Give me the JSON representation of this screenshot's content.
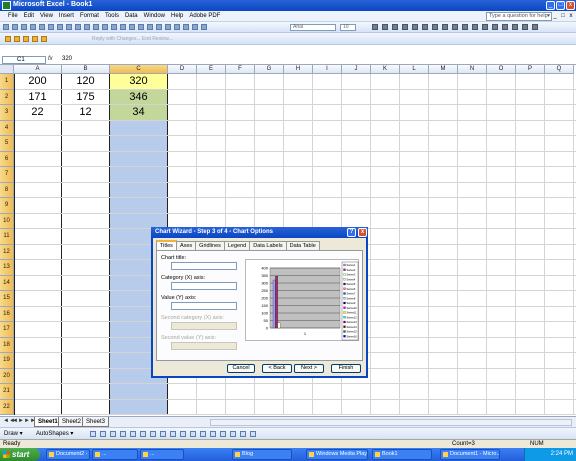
{
  "window": {
    "title": "Microsoft Excel - Book1",
    "controls": {
      "min": "_",
      "max": "□",
      "close": "x"
    }
  },
  "menu": {
    "items": [
      "File",
      "Edit",
      "View",
      "Insert",
      "Format",
      "Tools",
      "Data",
      "Window",
      "Help",
      "Adobe PDF"
    ],
    "help_placeholder": "Type a question for help",
    "help_arrow": "▾",
    "mdi": [
      "_",
      "□",
      "x"
    ]
  },
  "toolbar": {
    "reply_text": "Reply with Changes... End Review...",
    "font_name": "Arial",
    "font_size": "10"
  },
  "formula_bar": {
    "name_box": "C1",
    "fx_label": "fx",
    "formula": "320"
  },
  "grid": {
    "columns": [
      "A",
      "B",
      "C",
      "D",
      "E",
      "F",
      "G",
      "H",
      "I",
      "J",
      "K",
      "L",
      "M",
      "N",
      "O",
      "P",
      "Q"
    ],
    "rows": [
      "1",
      "2",
      "3",
      "4",
      "5",
      "6",
      "7",
      "8",
      "9",
      "10",
      "11",
      "12",
      "13",
      "14",
      "15",
      "16",
      "17",
      "18",
      "19",
      "20",
      "21",
      "22"
    ],
    "selected_column": "C",
    "cells": [
      {
        "row": 1,
        "col": "A",
        "value": "200"
      },
      {
        "row": 1,
        "col": "B",
        "value": "120"
      },
      {
        "row": 1,
        "col": "C",
        "value": "320",
        "bg": "#ffff99"
      },
      {
        "row": 2,
        "col": "A",
        "value": "171"
      },
      {
        "row": 2,
        "col": "B",
        "value": "175"
      },
      {
        "row": 2,
        "col": "C",
        "value": "346",
        "bg": "#c4d79b"
      },
      {
        "row": 3,
        "col": "A",
        "value": "22"
      },
      {
        "row": 3,
        "col": "B",
        "value": "12"
      },
      {
        "row": 3,
        "col": "C",
        "value": "34",
        "bg": "#c4d79b"
      }
    ]
  },
  "sheets": {
    "tabs": [
      "Sheet1",
      "Sheet2",
      "Sheet3"
    ],
    "active": "Sheet1",
    "nav": [
      "◄◄",
      "◄",
      "►",
      "►►"
    ]
  },
  "drawing_toolbar": {
    "draw_label": "Draw ▾",
    "autoshapes_label": "AutoShapes ▾"
  },
  "status": {
    "left": "Ready",
    "count": "Count=3",
    "num": "NUM"
  },
  "dialog": {
    "title": "Chart Wizard - Step 3 of 4 - Chart Options",
    "help_btn": "?",
    "close_btn": "x",
    "tabs": [
      "Titles",
      "Axes",
      "Gridlines",
      "Legend",
      "Data Labels",
      "Data Table"
    ],
    "active_tab": "Titles",
    "fields": {
      "chart_title": "Chart title:",
      "category_x": "Category (X) axis:",
      "value_y": "Value (Y) axis:",
      "second_category_x": "Second category (X) axis:",
      "second_value_y": "Second value (Y) axis:"
    },
    "buttons": {
      "cancel": "Cancel",
      "back": "< Back",
      "next": "Next >",
      "finish": "Finish"
    }
  },
  "chart_data": {
    "type": "bar",
    "categories": [
      "1"
    ],
    "ylim": [
      0,
      400
    ],
    "yticks": [
      "400",
      "350",
      "300",
      "250",
      "200",
      "150",
      "100",
      "50",
      "0"
    ],
    "series": [
      {
        "name": "Series1",
        "values": [
          320
        ],
        "color": "#9999ff"
      },
      {
        "name": "Series2",
        "values": [
          346
        ],
        "color": "#993366"
      },
      {
        "name": "Series3",
        "values": [
          34
        ],
        "color": "#ffffcc"
      }
    ],
    "legend_entries": [
      "Series1",
      "Series2",
      "Series3",
      "Series4",
      "Series5",
      "Series6",
      "Series7",
      "Series8",
      "Series9",
      "Series10",
      "Series11",
      "Series12",
      "Series13",
      "Series14",
      "Series15",
      "Series16"
    ],
    "plot_bg": "#c0c0c0"
  },
  "taskbar": {
    "start": "start",
    "items": [
      "Document2 - Micros...",
      "...",
      "...",
      "Blog",
      "Windows Media Player",
      "Book1",
      "Document1 - Micro..."
    ],
    "tray_time": "2:24 PM"
  }
}
